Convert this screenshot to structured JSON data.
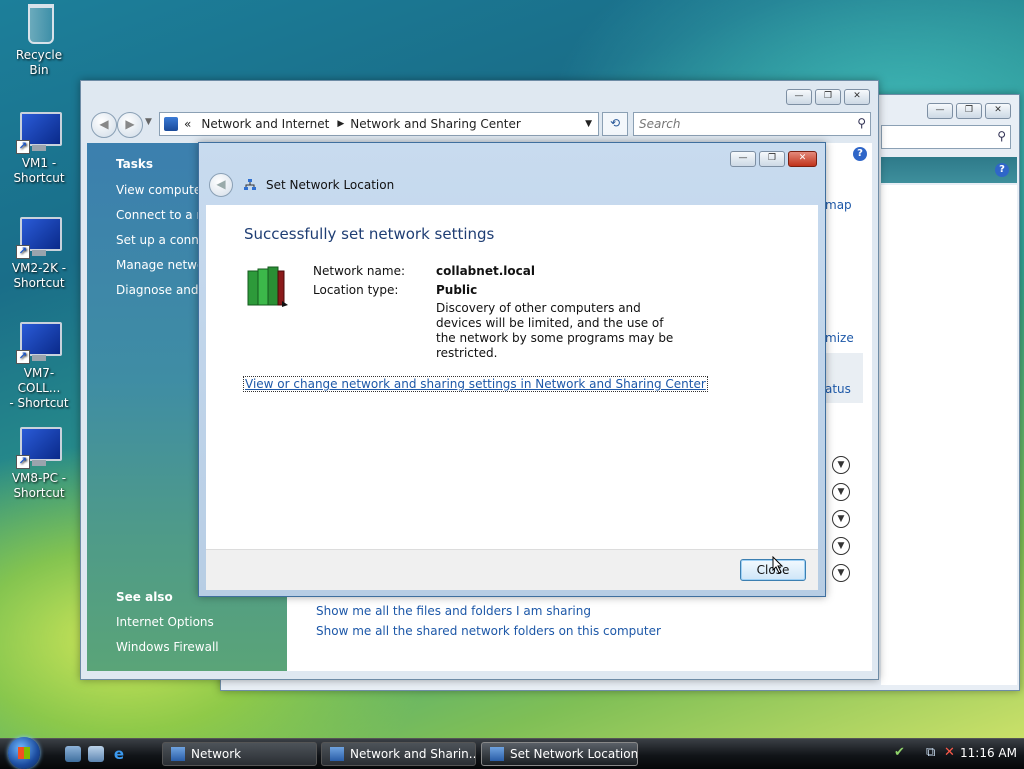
{
  "desktop": {
    "icons": [
      {
        "label": "Recycle Bin"
      },
      {
        "label": "VM1 -\nShortcut"
      },
      {
        "label": "VM2-2K -\nShortcut"
      },
      {
        "label": "VM7-COLL...\n- Shortcut"
      },
      {
        "label": "VM8-PC -\nShortcut"
      }
    ]
  },
  "main_window": {
    "breadcrumb_prefix": "«",
    "breadcrumb": [
      "Network and Internet",
      "Network and Sharing Center"
    ],
    "search_placeholder": "Search",
    "tasks": {
      "heading": "Tasks",
      "items": [
        "View computers and devices",
        "Connect to a network",
        "Set up a connection or network",
        "Manage network connections",
        "Diagnose and repair"
      ]
    },
    "see_also": {
      "heading": "See also",
      "items": [
        "Internet Options",
        "Windows Firewall"
      ]
    },
    "partial_links": [
      "map",
      "mize",
      "atus"
    ],
    "sharing_links": [
      "Show me all the files and folders I am sharing",
      "Show me all the shared network folders on this computer"
    ]
  },
  "dialog": {
    "title": "Set Network Location",
    "heading": "Successfully set network settings",
    "network_name_label": "Network name:",
    "network_name_value": "collabnet.local",
    "location_type_label": "Location type:",
    "location_type_value": "Public",
    "description": "Discovery of other computers and devices will be limited, and the use of the network by some programs may be restricted.",
    "link": "View or change network and sharing settings in Network and Sharing Center",
    "close_label": "Close"
  },
  "taskbar": {
    "buttons": [
      "Network",
      "Network and Sharin...",
      "Set Network Location"
    ],
    "clock": "11:16 AM"
  }
}
